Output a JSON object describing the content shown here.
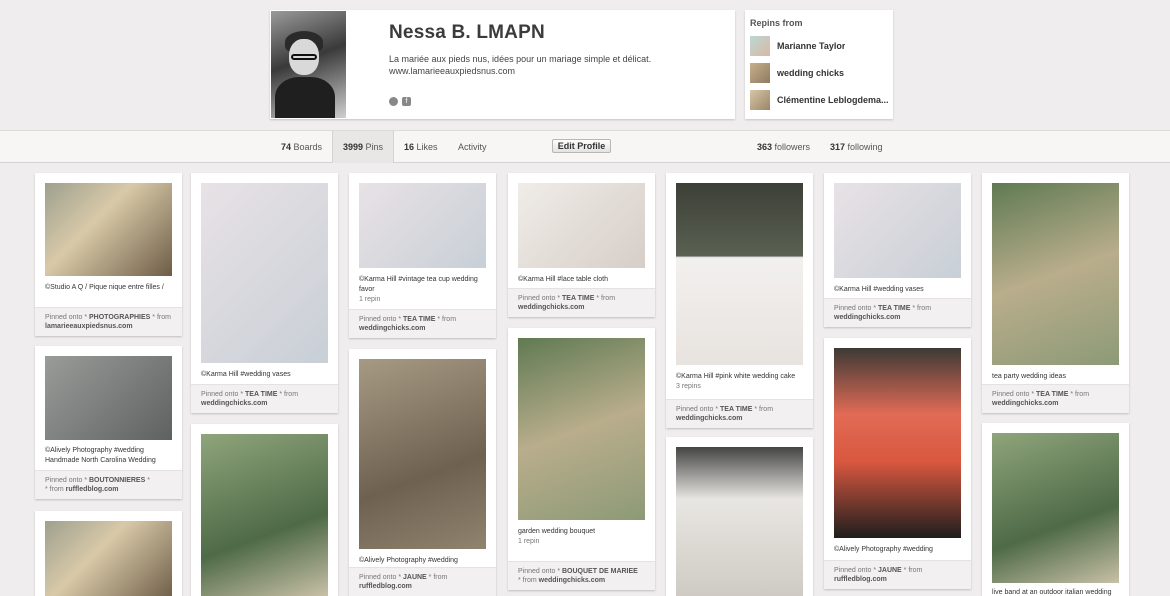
{
  "profile": {
    "name": "Nessa B. LMAPN",
    "about": "La mariée aux pieds nus, idées pour un mariage simple et délicat.",
    "website": "www.lamarieeauxpiedsnus.com"
  },
  "repins": {
    "title": "Repins from",
    "users": [
      "Marianne Taylor",
      "wedding chicks",
      "Clémentine Leblogdema..."
    ]
  },
  "nav": {
    "boards": {
      "count": "74",
      "label": "Boards"
    },
    "pins": {
      "count": "3999",
      "label": "Pins"
    },
    "likes": {
      "count": "16",
      "label": "Likes"
    },
    "activity": "Activity",
    "edit_profile": "Edit Profile",
    "followers": {
      "count": "363",
      "label": "followers"
    },
    "following": {
      "count": "317",
      "label": "following"
    }
  },
  "pins": [
    {
      "desc": "©Studio A Q / Pique nique entre filles /",
      "repins": "",
      "board": "PHOTOGRAPHIES",
      "source": "lamarieeauxpiedsnus.com"
    },
    {
      "desc": "©Alively Photography #wedding Handmade North Carolina Wedding",
      "repins": "",
      "board": "BOUTONNIERES",
      "source": "ruffledblog.com"
    },
    {
      "desc": "",
      "repins": "",
      "board": "",
      "source": ""
    },
    {
      "desc": "©Karma Hill #wedding vases",
      "repins": "",
      "board": "TEA TIME",
      "source": "weddingchicks.com"
    },
    {
      "desc": "",
      "repins": "",
      "board": "",
      "source": ""
    },
    {
      "desc": "©Karma Hill #vintage tea cup wedding favor",
      "repins": "1 repin",
      "board": "TEA TIME",
      "source": "weddingchicks.com"
    },
    {
      "desc": "©Alively Photography #wedding",
      "repins": "",
      "board": "JAUNE",
      "source": "ruffledblog.com"
    },
    {
      "desc": "©Karma Hill #lace table cloth",
      "repins": "",
      "board": "TEA TIME",
      "source": "weddingchicks.com"
    },
    {
      "desc": "garden wedding bouquet",
      "repins": "1 repin",
      "board": "BOUQUET DE MARIEE",
      "source": "weddingchicks.com"
    },
    {
      "desc": "©Karma Hill #pink white wedding cake",
      "repins": "3 repins",
      "board": "TEA TIME",
      "source": "weddingchicks.com"
    },
    {
      "desc": "",
      "repins": "",
      "board": "",
      "source": ""
    },
    {
      "desc": "©Karma Hill #wedding vases",
      "repins": "",
      "board": "TEA TIME",
      "source": "weddingchicks.com"
    },
    {
      "desc": "©Alively Photography #wedding",
      "repins": "",
      "board": "JAUNE",
      "source": "ruffledblog.com"
    },
    {
      "desc": "tea party wedding ideas",
      "repins": "",
      "board": "TEA TIME",
      "source": "weddingchicks.com"
    },
    {
      "desc": "live band at an outdoor italian wedding",
      "repins": "",
      "board": "",
      "source": ""
    }
  ],
  "labels": {
    "pinned_onto": "Pinned onto",
    "from": "from"
  },
  "icons": {
    "globe": "globe-icon",
    "facebook": "facebook-icon"
  }
}
